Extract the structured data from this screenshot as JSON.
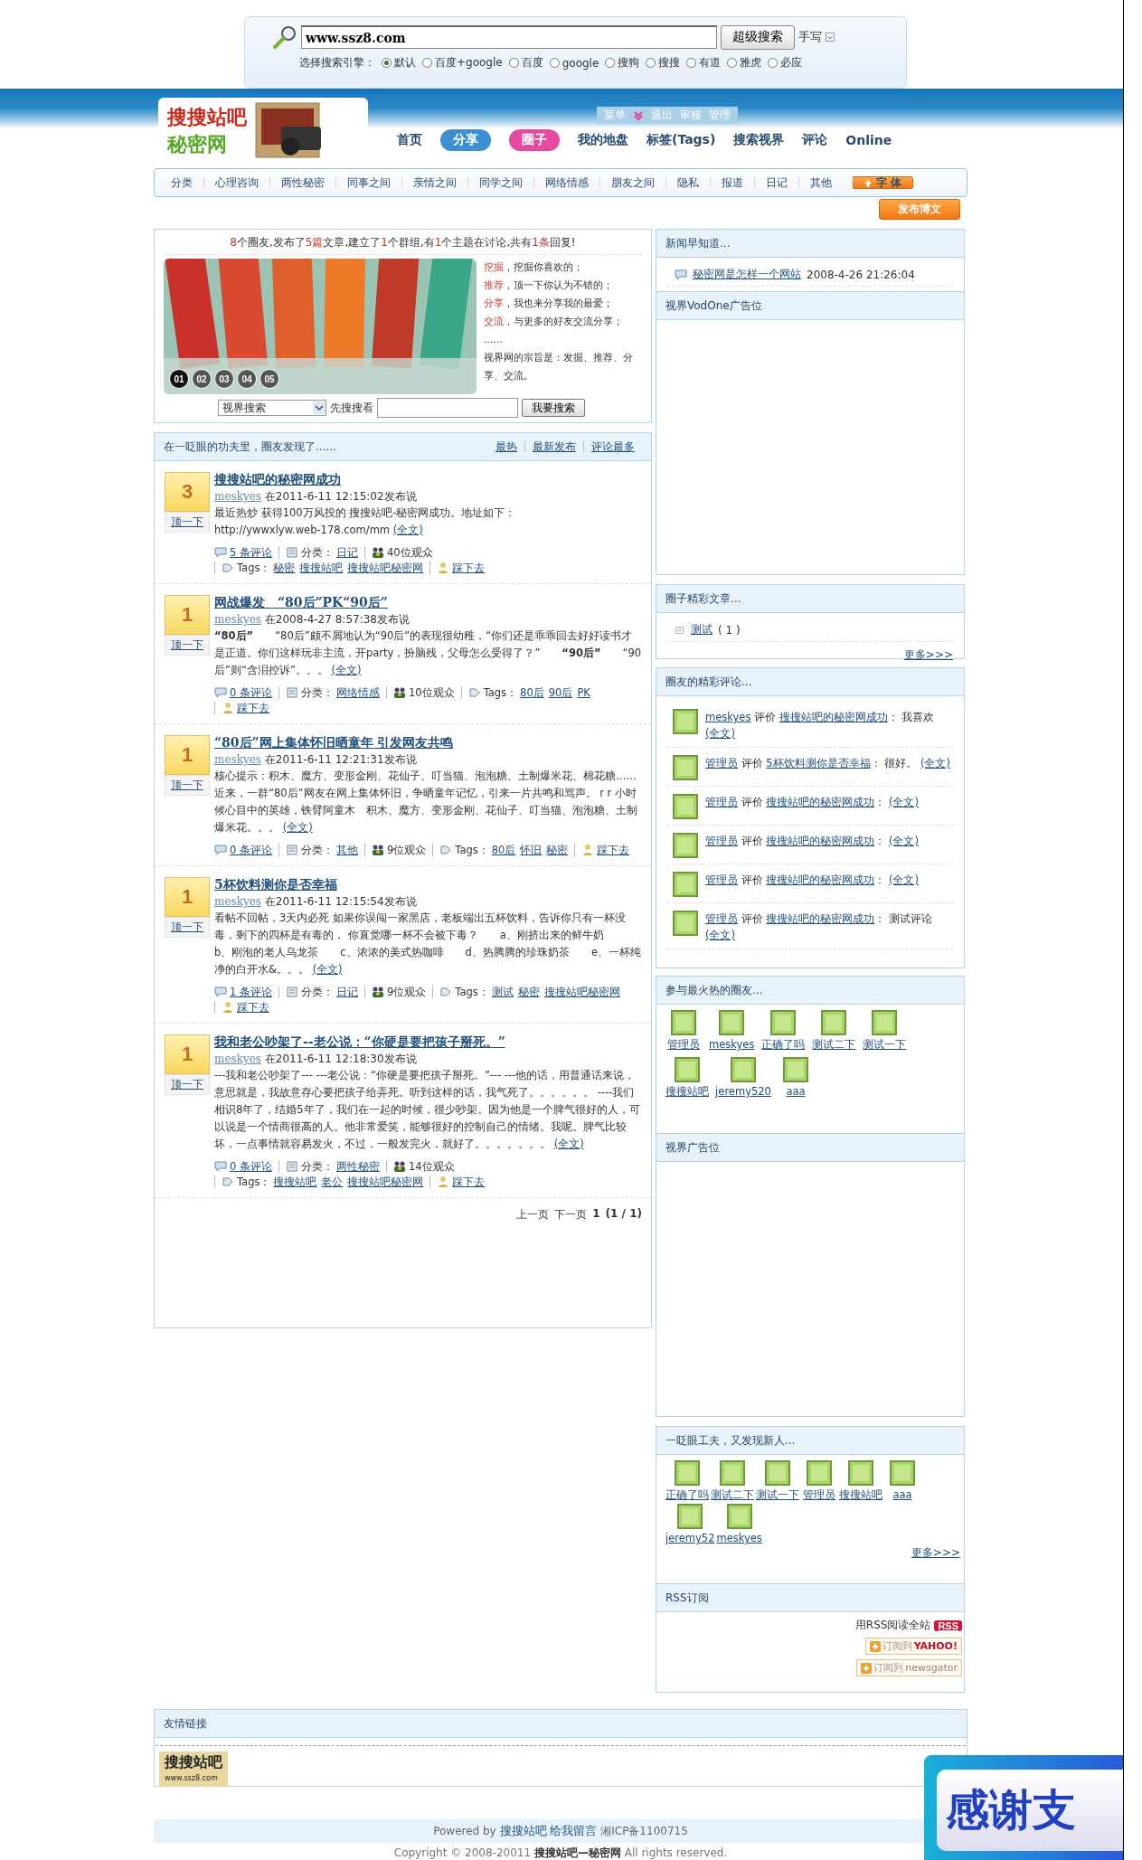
{
  "search": {
    "value": "www.ssz8.com",
    "button": "超级搜索",
    "handwrite": "手写",
    "engine_label": "选择搜索引擎：",
    "engines": [
      {
        "label": "默认",
        "selected": true
      },
      {
        "label": "百度+google",
        "selected": false
      },
      {
        "label": "百度",
        "selected": false
      },
      {
        "label": "google",
        "selected": false
      },
      {
        "label": "搜狗",
        "selected": false
      },
      {
        "label": "搜搜",
        "selected": false
      },
      {
        "label": "有道",
        "selected": false
      },
      {
        "label": "雅虎",
        "selected": false
      },
      {
        "label": "必应",
        "selected": false
      }
    ]
  },
  "header": {
    "logo_top": "搜搜站吧",
    "logo_bottom": "秘密网",
    "user_links": [
      "菜单",
      "退出",
      "审核",
      "管理"
    ],
    "nav": [
      {
        "label": "首页",
        "kind": "text"
      },
      {
        "label": "分享",
        "kind": "cloud",
        "color": "#3b8fd3"
      },
      {
        "label": "圈子",
        "kind": "cloud",
        "color": "#e64a9e"
      },
      {
        "label": "我的地盘",
        "kind": "text"
      },
      {
        "label": "标签(Tags)",
        "kind": "text"
      },
      {
        "label": "搜索视界",
        "kind": "text"
      },
      {
        "label": "评论",
        "kind": "text"
      },
      {
        "label": "Online",
        "kind": "text"
      }
    ]
  },
  "categories": [
    "分类",
    "心理咨询",
    "两性秘密",
    "同事之间",
    "亲情之间",
    "同学之间",
    "网络情感",
    "朋友之间",
    "隐私",
    "报道",
    "日记",
    "其他"
  ],
  "font_button": "字 体",
  "publish_button": "发布博文",
  "intro": {
    "stats": [
      {
        "text": "8",
        "highlight": true
      },
      {
        "text": "个圈友,发布了",
        "highlight": false
      },
      {
        "text": "5篇",
        "highlight": true
      },
      {
        "text": "文章,建立了",
        "highlight": false
      },
      {
        "text": "1",
        "highlight": true
      },
      {
        "text": "个群组,有",
        "highlight": false
      },
      {
        "text": "1",
        "highlight": true
      },
      {
        "text": "个主题在讨论,共有",
        "highlight": false
      },
      {
        "text": "1条",
        "highlight": true
      },
      {
        "text": "回复!",
        "highlight": false
      }
    ],
    "slides": [
      {
        "label": "01",
        "selected": true
      },
      {
        "label": "02",
        "selected": false
      },
      {
        "label": "03",
        "selected": false
      },
      {
        "label": "04",
        "selected": false
      },
      {
        "label": "05",
        "selected": false
      }
    ],
    "mottos": [
      {
        "key": "挖掘",
        "text": "，挖掘你喜欢的；"
      },
      {
        "key": "推荐",
        "text": "，顶一下你认为不错的；"
      },
      {
        "key": "分享",
        "text": "，我也来分享我的最爱；"
      },
      {
        "key": "交流",
        "text": "，与更多的好友交流分享；"
      }
    ],
    "ellipsis": "......",
    "purpose": "视界网的宗旨是：发掘、推荐、分享、交流。",
    "select": "视界搜索",
    "field_label": "先搜搜看",
    "button": "我要搜索"
  },
  "articles": {
    "heading": "在一眨眼的功夫里，圈友发现了......",
    "sorts": [
      "最热",
      "最新发布",
      "评论最多"
    ],
    "items": [
      {
        "votes": "3",
        "vote": "顶一下",
        "title": "搜搜站吧的秘密网成功",
        "author": "meskyes",
        "posted": "在2011-6-11 12:15:02发布说",
        "body": "最近热炒 获得100万风投的 搜搜站吧-秘密网成功。地址如下：　　　　　　　　　　　　　　　　　　　　　　 http://ywwxlyw.web-178.com/mm",
        "more": "(全文)",
        "comments": "5 条评论",
        "category_label": "分类：",
        "category": "日记",
        "views": "40位观众",
        "tags_label": "Tags：",
        "tags": [
          "秘密",
          "搜搜站吧",
          "搜搜站吧秘密网"
        ],
        "down": "踩下去"
      },
      {
        "votes": "1",
        "vote": "顶一下",
        "title": "网战爆发　“80后”PK“90后”",
        "author": "meskyes",
        "posted": "在2008-4-27 8:57:38发布说",
        "body": "**“80后”**　　“80后”颇不屑地认为“90后”的表现很幼稚，“你们还是乖乖回去好好读书才是正道。你们这样玩非主流，开party，扮脑残，父母怎么受得了？”　　**“90后”**　　“90后”则“含泪控诉”。。。",
        "more": "(全文)",
        "comments": "0 条评论",
        "category_label": "分类：",
        "category": "网络情感",
        "views": "10位观众",
        "tags_label": "Tags：",
        "tags": [
          "80后",
          "90后",
          "PK"
        ],
        "down": "踩下去"
      },
      {
        "votes": "1",
        "vote": "顶一下",
        "title": "“80后”网上集体怀旧晒童年 引发网友共鸣",
        "author": "meskyes",
        "posted": "在2011-6-11 12:21:31发布说",
        "body": "核心提示：积木、魔方、变形金刚、花仙子、叮当猫、泡泡糖、土制爆米花、棉花糖……近来，一群“80后”网友在网上集体怀旧，争晒童年记忆，引来一片共鸣和骂声。 r r 小时候心目中的英雄，铁臂阿童木　积木、魔方、变形金刚、花仙子、叮当猫、泡泡糖、土制爆米花。。。",
        "more": "(全文)",
        "comments": "0 条评论",
        "category_label": "分类：",
        "category": "其他",
        "views": "9位观众",
        "tags_label": "Tags：",
        "tags": [
          "80后",
          "怀旧",
          "秘密"
        ],
        "down": "踩下去"
      },
      {
        "votes": "1",
        "vote": "顶一下",
        "title": "5杯饮料测你是否幸福",
        "author": "meskyes",
        "posted": "在2011-6-11 12:15:54发布说",
        "body": "看帖不回帖，3天内必死 如果你误闯一家黑店，老板端出五杯饮料，告诉你只有一杯没毒，剩下的四杯是有毒的， 你直觉哪一杯不会被下毒？　　a、刚挤出来的鲜牛奶　　b、刚泡的老人乌龙茶　　c、浓浓的美式热咖啡　　d、热腾腾的珍珠奶茶　　e、一杯纯净的白开水&。。。",
        "more": "(全文)",
        "comments": "1 条评论",
        "category_label": "分类：",
        "category": "日记",
        "views": "9位观众",
        "tags_label": "Tags：",
        "tags": [
          "测试",
          "秘密",
          "搜搜站吧秘密网"
        ],
        "down": "踩下去"
      },
      {
        "votes": "1",
        "vote": "顶一下",
        "title": "我和老公吵架了--老公说：“你硬是要把孩子掰死。”",
        "author": "meskyes",
        "posted": "在2011-6-11 12:18:30发布说",
        "body": "---我和老公吵架了--- ---老公说：“你硬是要把孩子掰死。”--- ---他的话，用普通话来说，意思就是，我故意存心要把孩子给弄死。听到这样的话，我气死了。。。。。。 ----我们相识8年了，结婚5年了，我们在一起的时候，很少吵架。因为他是一个脾气很好的人，可以说是一个情商很高的人。他非常爱笑，能够很好的控制自己的情绪。我呢。脾气比较坏，一点事情就容易发火，不过，一般发完火，就好了。。。。。。。",
        "more": "(全文)",
        "comments": "0 条评论",
        "category_label": "分类：",
        "category": "两性秘密",
        "views": "14位观众",
        "tags_label": "Tags：",
        "tags": [
          "搜搜站吧",
          "老公",
          "搜搜站吧秘密网"
        ],
        "down": "踩下去"
      }
    ],
    "pager": {
      "prev": "上一页",
      "next": "下一页",
      "page": "1",
      "total": "(1 / 1)"
    }
  },
  "sidebar": {
    "news": {
      "title": "新闻早知道...",
      "items": [
        {
          "title": "秘密网是怎样一个网站",
          "date": "2008-4-26 21:26:04"
        }
      ]
    },
    "ad_top": {
      "title": "视界VodOne广告位"
    },
    "circle_articles": {
      "title": "圈子精彩文章...",
      "items": [
        {
          "title": "测试",
          "count": "( 1 )"
        }
      ],
      "more": "更多>>>"
    },
    "comments": {
      "title": "圈友的精彩评论...",
      "items": [
        {
          "user": "meskyes",
          "verb": "评价",
          "article": "搜搜站吧的秘密网成功",
          "text": "：  我喜欢",
          "more": "(全文)"
        },
        {
          "user": "管理员",
          "verb": "评价",
          "article": "5杯饮料测你是否幸福",
          "text": "：  很好。",
          "more": "(全文)"
        },
        {
          "user": "管理员",
          "verb": "评价",
          "article": "搜搜站吧的秘密网成功",
          "text": "：",
          "more": "(全文)"
        },
        {
          "user": "管理员",
          "verb": "评价",
          "article": "搜搜站吧的秘密网成功",
          "text": "：",
          "more": "(全文)"
        },
        {
          "user": "管理员",
          "verb": "评价",
          "article": "搜搜站吧的秘密网成功",
          "text": "：",
          "more": "(全文)"
        },
        {
          "user": "管理员",
          "verb": "评价",
          "article": "搜搜站吧的秘密网成功",
          "text": "：  测试评论",
          "more": "(全文)"
        }
      ]
    },
    "hot_members": {
      "title": "参与最火热的圈友...",
      "members": [
        "管理员",
        "meskyes",
        "正确了吗",
        "测试二下",
        "测试一下",
        "搜搜站吧",
        "jeremy520",
        "aaa"
      ]
    },
    "ad_bottom": {
      "title": "视界广告位"
    },
    "new_members": {
      "title": "一眨眼工夫，又发现新人...",
      "members": [
        "正确了吗",
        "测试二下",
        "测试一下",
        "管理员",
        "搜搜站吧",
        "aaa",
        "jeremy52",
        "meskyes"
      ],
      "more": "更多>>>"
    },
    "rss": {
      "title": "RSS订阅",
      "text": "用RSS阅读全站",
      "badge": "RSS",
      "subscribe": [
        {
          "label": "订阅到",
          "brand": "YAHOO!"
        },
        {
          "label": "订阅到",
          "brand": "newsgator"
        }
      ]
    }
  },
  "links": {
    "title": "友情链接",
    "logo": "搜搜站吧",
    "logo_url": "www.ssz8.com"
  },
  "footer": {
    "powered": "Powered by",
    "site": "搜搜站吧",
    "message": "给我留言",
    "icp": "湘ICP备1100715",
    "copyright": "Copyright © 2008-20011",
    "name": "搜搜站吧—秘密网",
    "rights": "All rights reserved."
  },
  "popup": {
    "text": "感谢支"
  }
}
